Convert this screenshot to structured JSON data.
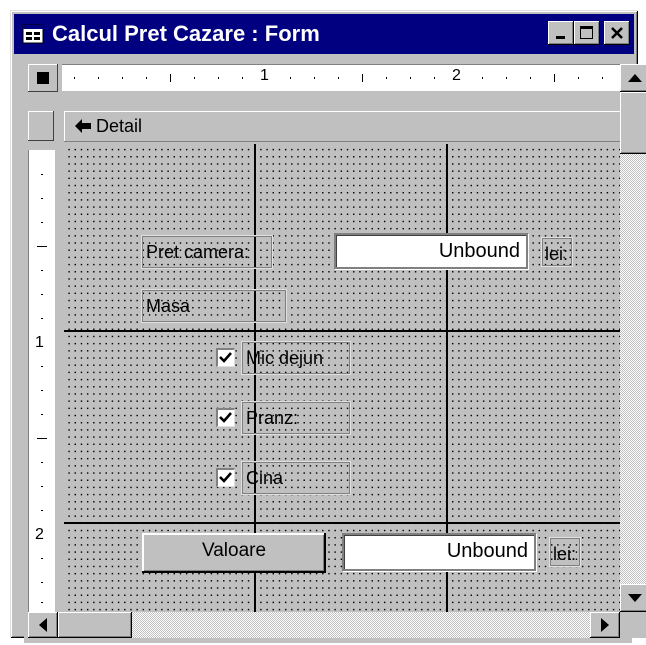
{
  "window": {
    "title": "Calcul Pret Cazare : Form",
    "minimize_glyph": "_",
    "maximize_glyph": "□",
    "close_glyph": "✕"
  },
  "rulers": {
    "horizontal_marks": [
      "1",
      "2"
    ],
    "vertical_marks": [
      "1",
      "2"
    ]
  },
  "section": {
    "label": "Detail"
  },
  "form": {
    "pret_camera_label": "Pret camera:",
    "pret_camera_value": "Unbound",
    "currency_1": "lei:",
    "masa_label": "Masa",
    "options": [
      {
        "label": "Mic dejun",
        "checked": true
      },
      {
        "label": "Pranz:",
        "checked": true
      },
      {
        "label": "Cina",
        "checked": true
      }
    ],
    "valoare_button": "Valoare",
    "valoare_value": "Unbound",
    "currency_2": "lei:"
  }
}
